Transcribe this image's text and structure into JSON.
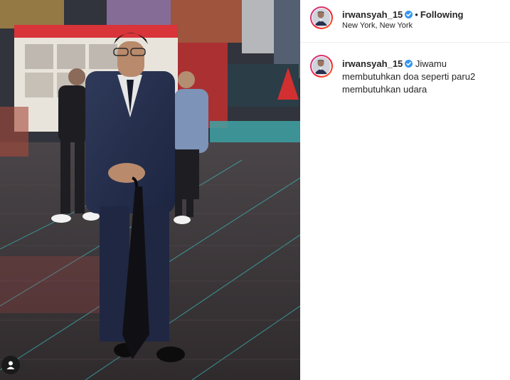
{
  "post": {
    "username": "irwansyah_15",
    "follow_separator": "•",
    "follow_status": "Following",
    "location": "New York, New York",
    "caption": "Jiwamu membutuhkan doa seperti paru2 membutuhkan udara"
  },
  "photo": {
    "user_tag_icon": "user-tag-icon"
  },
  "colors": {
    "verified_badge": "#3897f0",
    "text": "#262626",
    "divider": "#efefef"
  }
}
